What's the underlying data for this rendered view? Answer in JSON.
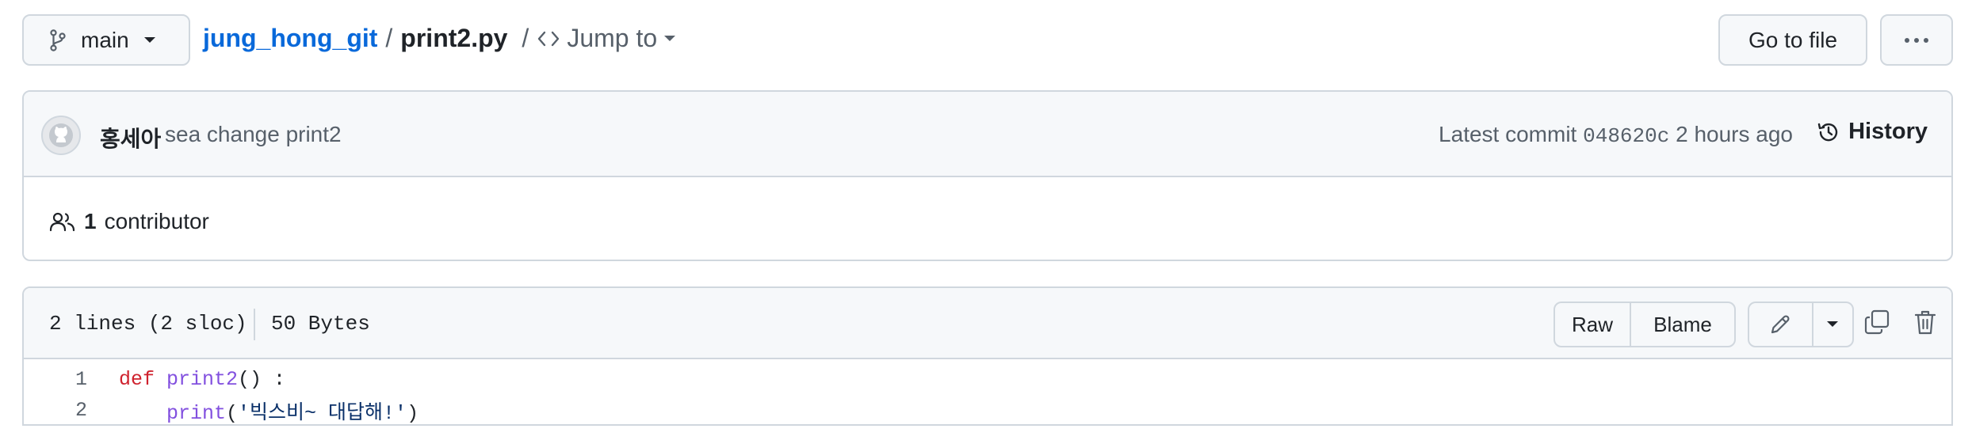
{
  "branch": {
    "label": "main"
  },
  "breadcrumb": {
    "repo": "jung_hong_git",
    "separator": "/",
    "file": "print2.py",
    "jump_label": "Jump to"
  },
  "toolbar": {
    "goto_file_label": "Go to file",
    "more_label": "···"
  },
  "commit": {
    "author": "홍세아",
    "message": "sea change print2",
    "latest_label": "Latest commit",
    "sha": "048620c",
    "time": "2 hours ago",
    "history_label": "History"
  },
  "contributors": {
    "count": "1",
    "label": "contributor"
  },
  "file": {
    "lines_info": "2 lines (2 sloc)",
    "size": "50 Bytes",
    "raw_label": "Raw",
    "blame_label": "Blame"
  },
  "code": {
    "lines": [
      {
        "number": "1",
        "indent": "",
        "kw": "def",
        "fn": " print2",
        "rest": "() :",
        "str": "",
        "tail": ""
      },
      {
        "number": "2",
        "indent": "    ",
        "kw": "",
        "fn": "print",
        "rest": "(",
        "str": "'빅스비~ 대답해!'",
        "tail": ")"
      }
    ]
  },
  "colors": {
    "link": "#0969da",
    "keyword": "#cf222e",
    "function": "#8250df",
    "string": "#0a3069",
    "border": "#d0d7de",
    "header_bg": "#f6f8fa"
  },
  "icons": [
    "git-branch-icon",
    "caret-down-icon",
    "code-icon",
    "kebab-horizontal-icon",
    "avatar-icon",
    "history-icon",
    "people-icon",
    "pencil-icon",
    "copy-icon",
    "trash-icon"
  ]
}
